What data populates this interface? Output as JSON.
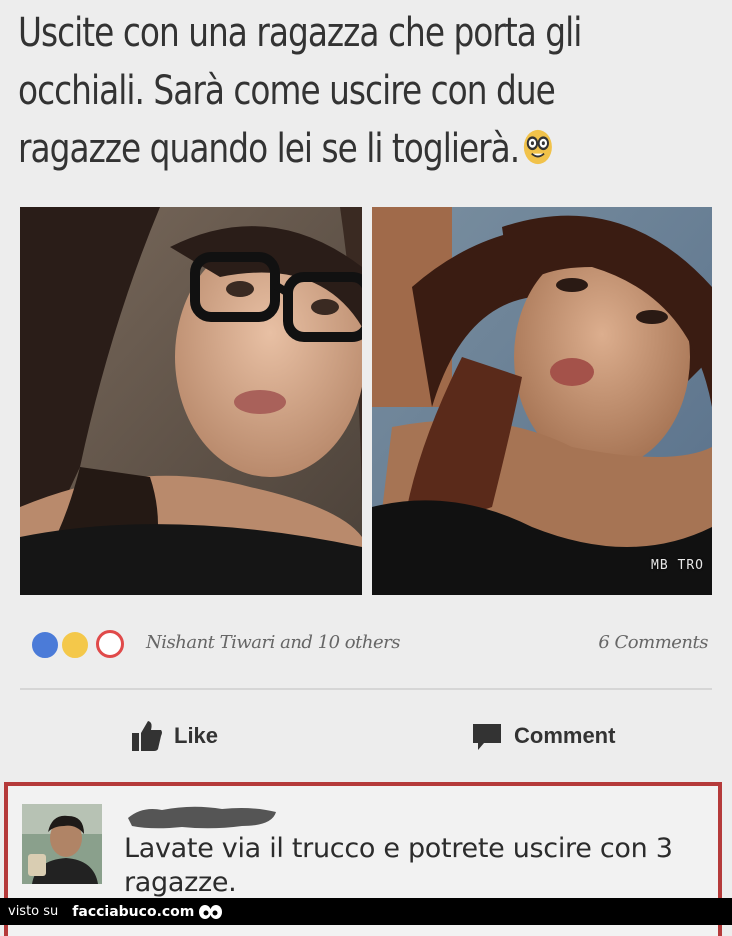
{
  "caption": {
    "line1": "Uscite con una ragazza che porta gli",
    "line2": "occhiali. Sarà come uscire con due",
    "line3": "ragazze quando lei se li toglierà."
  },
  "photos": {
    "right_watermark": "MB TRO"
  },
  "post_stats": {
    "reactors": "Nishant Tiwari and 10 others",
    "comments_count": "6 Comments"
  },
  "actions": {
    "like_label": "Like",
    "comment_label": "Comment"
  },
  "comment": {
    "text": "Lavate via il trucco e potrete uscire con 3 ragazze."
  },
  "footer": {
    "prefix": "visto su",
    "site": "facciabuco.com"
  },
  "colors": {
    "like_blue": "#4b7bd8",
    "highlight_border": "#b53a3a",
    "footer_bg": "#000000"
  }
}
